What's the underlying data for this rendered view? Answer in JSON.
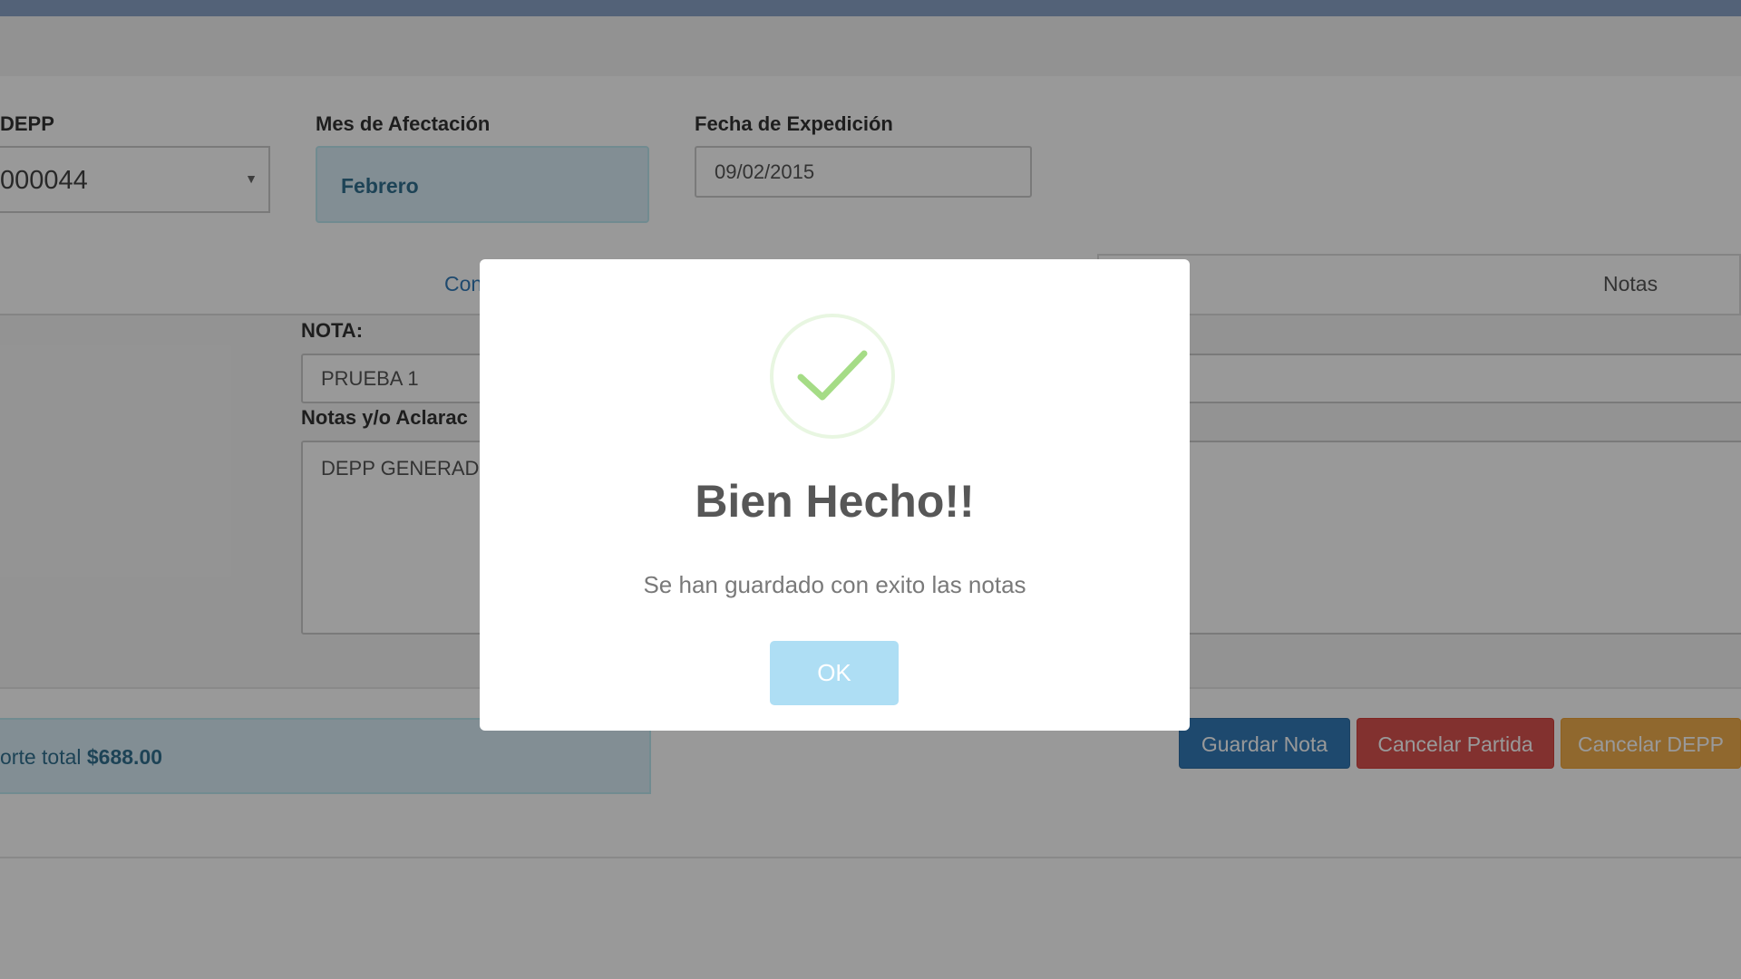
{
  "form": {
    "depp_label": "DEPP",
    "depp_value": "000044",
    "mes_label": "Mes de Afectación",
    "mes_value": "Febrero",
    "fecha_label": "Fecha de Expedición",
    "fecha_value": "09/02/2015"
  },
  "tabs": {
    "left_partial": "Con",
    "notas": "Notas"
  },
  "notes": {
    "nota_label": "NOTA:",
    "nota_value": "PRUEBA 1",
    "aclaraciones_label": "Notas y/o Aclarac",
    "aclaraciones_value": "DEPP GENERADO"
  },
  "total": {
    "label": "orte total",
    "amount": "$688.00"
  },
  "buttons": {
    "guardar_nota": "Guardar Nota",
    "cancelar_partida": "Cancelar Partida",
    "cancelar_depp": "Cancelar DEPP"
  },
  "modal": {
    "icon": "success-check-icon",
    "title": "Bien Hecho!!",
    "text": "Se han guardado con exito las notas",
    "ok_label": "OK"
  },
  "colors": {
    "primary": "#337ab7",
    "danger": "#d9534f",
    "warning": "#f0ad4e",
    "info_bg": "#d9edf7",
    "success_check": "#a5dc86"
  }
}
